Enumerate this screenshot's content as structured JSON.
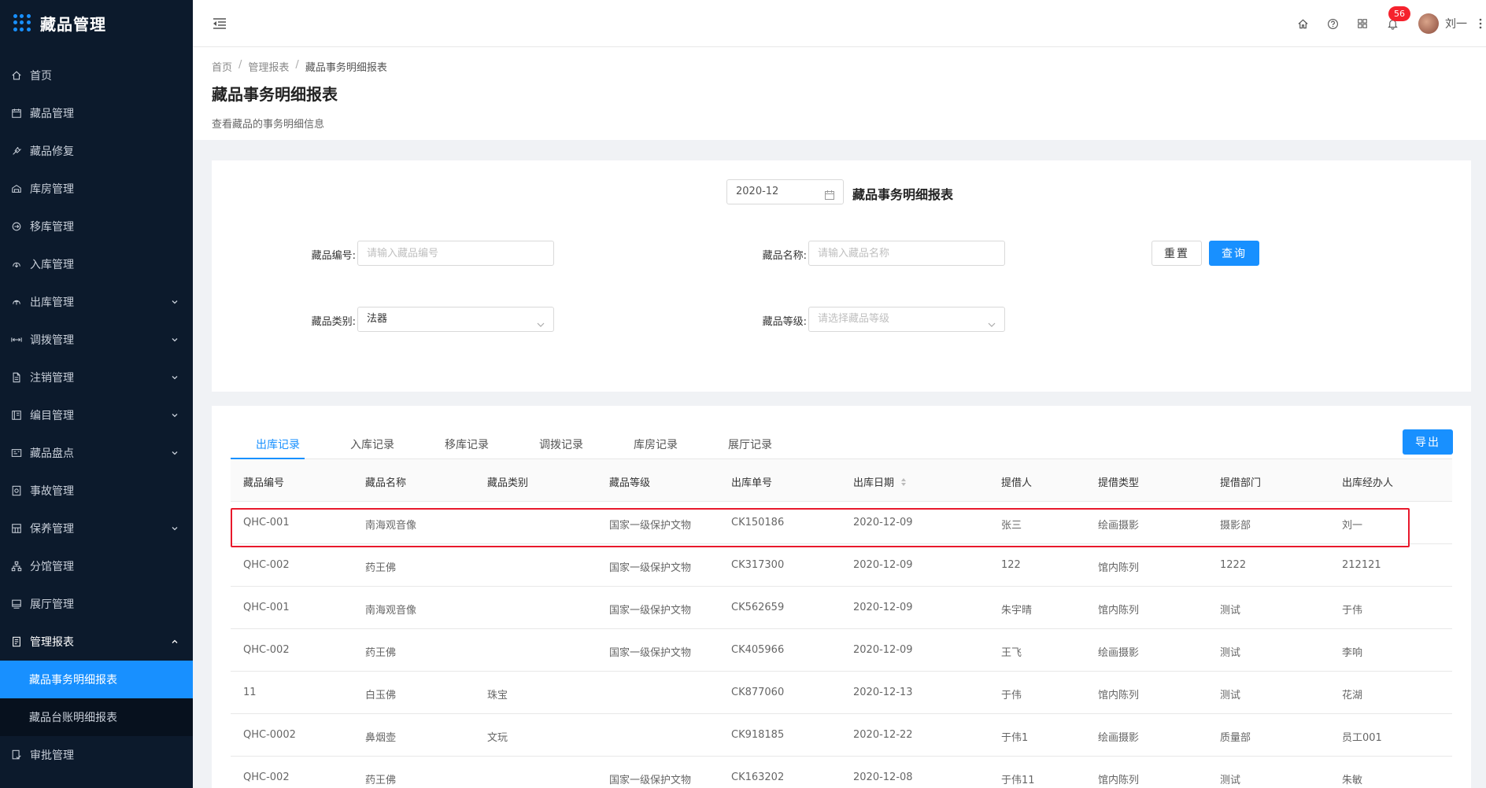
{
  "app": {
    "title": "藏品管理"
  },
  "sidebar": {
    "items": [
      {
        "label": "首页",
        "icon": "home-icon",
        "expandable": false
      },
      {
        "label": "藏品管理",
        "icon": "calendar-icon",
        "expandable": false
      },
      {
        "label": "藏品修复",
        "icon": "wrench-icon",
        "expandable": false
      },
      {
        "label": "库房管理",
        "icon": "warehouse-icon",
        "expandable": false
      },
      {
        "label": "移库管理",
        "icon": "transfer-icon",
        "expandable": false
      },
      {
        "label": "入库管理",
        "icon": "inbound-icon",
        "expandable": false
      },
      {
        "label": "出库管理",
        "icon": "outbound-icon",
        "expandable": true
      },
      {
        "label": "调拨管理",
        "icon": "allocate-icon",
        "expandable": true
      },
      {
        "label": "注销管理",
        "icon": "document-icon",
        "expandable": true
      },
      {
        "label": "编目管理",
        "icon": "catalog-icon",
        "expandable": true
      },
      {
        "label": "藏品盘点",
        "icon": "inventory-icon",
        "expandable": true
      },
      {
        "label": "事故管理",
        "icon": "accident-icon",
        "expandable": false
      },
      {
        "label": "保养管理",
        "icon": "maintain-icon",
        "expandable": true
      },
      {
        "label": "分馆管理",
        "icon": "branch-icon",
        "expandable": false
      },
      {
        "label": "展厅管理",
        "icon": "hall-icon",
        "expandable": false
      },
      {
        "label": "管理报表",
        "icon": "report-icon",
        "expandable": true,
        "open": true
      }
    ],
    "sub_items": [
      {
        "label": "藏品事务明细报表",
        "active": true
      },
      {
        "label": "藏品台账明细报表",
        "active": false
      }
    ],
    "last_item": {
      "label": "审批管理",
      "icon": "approve-icon"
    }
  },
  "header": {
    "notification_count": "56",
    "user_name": "刘一"
  },
  "breadcrumb": [
    "首页",
    "管理报表",
    "藏品事务明细报表"
  ],
  "page": {
    "title": "藏品事务明细报表",
    "description": "查看藏品的事务明细信息"
  },
  "filter": {
    "month_value": "2020-12",
    "report_title": "藏品事务明细报表",
    "code_label": "藏品编号:",
    "code_placeholder": "请输入藏品编号",
    "name_label": "藏品名称:",
    "name_placeholder": "请输入藏品名称",
    "category_label": "藏品类别:",
    "category_value": "法器",
    "grade_label": "藏品等级:",
    "grade_placeholder": "请选择藏品等级",
    "reset_label": "重置",
    "search_label": "查询"
  },
  "tabs": [
    {
      "label": "出库记录",
      "active": true
    },
    {
      "label": "入库记录",
      "active": false
    },
    {
      "label": "移库记录",
      "active": false
    },
    {
      "label": "调拨记录",
      "active": false
    },
    {
      "label": "库房记录",
      "active": false
    },
    {
      "label": "展厅记录",
      "active": false
    }
  ],
  "export_label": "导出",
  "table": {
    "columns": [
      "藏品编号",
      "藏品名称",
      "藏品类别",
      "藏品等级",
      "出库单号",
      "出库日期",
      "提借人",
      "提借类型",
      "提借部门",
      "出库经办人"
    ],
    "rows": [
      [
        "QHC-001",
        "南海观音像",
        "",
        "国家一级保护文物",
        "CK150186",
        "2020-12-09",
        "张三",
        "绘画摄影",
        "摄影部",
        "刘一"
      ],
      [
        "QHC-002",
        "药王佛",
        "",
        "国家一级保护文物",
        "CK317300",
        "2020-12-09",
        "122",
        "馆内陈列",
        "1222",
        "212121"
      ],
      [
        "QHC-001",
        "南海观音像",
        "",
        "国家一级保护文物",
        "CK562659",
        "2020-12-09",
        "朱宇晴",
        "馆内陈列",
        "测试",
        "于伟"
      ],
      [
        "QHC-002",
        "药王佛",
        "",
        "国家一级保护文物",
        "CK405966",
        "2020-12-09",
        "王飞",
        "绘画摄影",
        "测试",
        "李响"
      ],
      [
        "11",
        "白玉佛",
        "珠宝",
        "",
        "CK877060",
        "2020-12-13",
        "于伟",
        "馆内陈列",
        "测试",
        "花湖"
      ],
      [
        "QHC-0002",
        "鼻烟壶",
        "文玩",
        "",
        "CK918185",
        "2020-12-22",
        "于伟1",
        "绘画摄影",
        "质量部",
        "员工001"
      ],
      [
        "QHC-002",
        "药王佛",
        "",
        "国家一级保护文物",
        "CK163202",
        "2020-12-08",
        "于伟11",
        "馆内陈列",
        "测试",
        "朱敏"
      ]
    ]
  },
  "colors": {
    "accent": "#1890ff",
    "sidebar_bg": "#0c1a2c",
    "highlight": "#e8192c"
  }
}
